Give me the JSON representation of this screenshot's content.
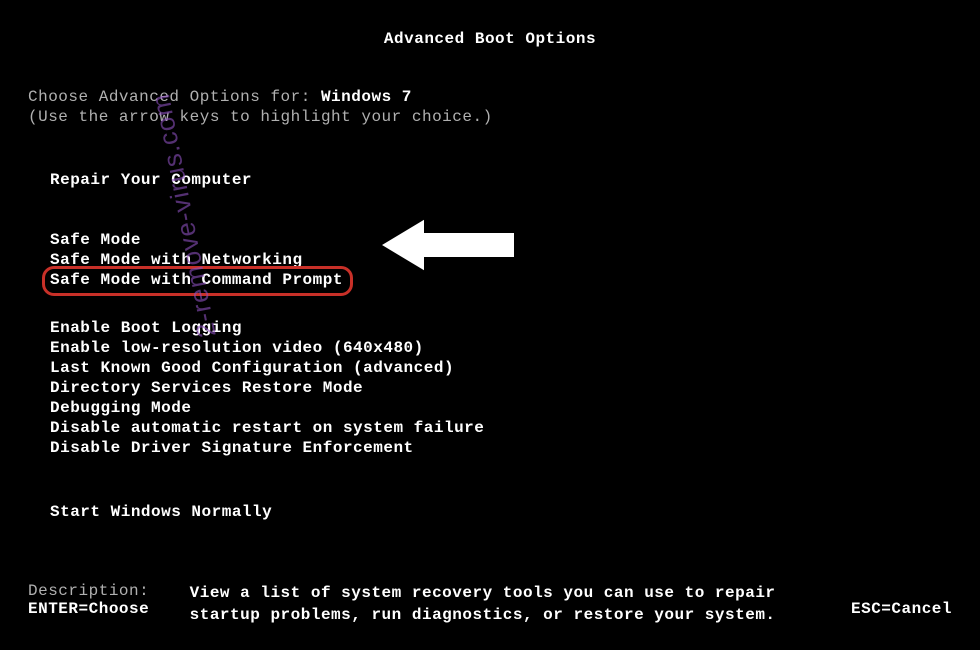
{
  "header": {
    "title": "Advanced Boot Options"
  },
  "choose": {
    "prefix": "Choose Advanced Options for: ",
    "os_name": "Windows 7",
    "hint": "(Use the arrow keys to highlight your choice.)"
  },
  "groups": {
    "repair": "Repair Your Computer",
    "safe": [
      "Safe Mode",
      "Safe Mode with Networking",
      "Safe Mode with Command Prompt"
    ],
    "advanced": [
      "Enable Boot Logging",
      "Enable low-resolution video (640x480)",
      "Last Known Good Configuration (advanced)",
      "Directory Services Restore Mode",
      "Debugging Mode",
      "Disable automatic restart on system failure",
      "Disable Driver Signature Enforcement"
    ],
    "normal": "Start Windows Normally"
  },
  "description": {
    "label": "Description:    ",
    "line1": "View a list of system recovery tools you can use to repair",
    "line2": "startup problems, run diagnostics, or restore your system."
  },
  "footer": {
    "enter": "ENTER=Choose",
    "esc": "ESC=Cancel"
  },
  "watermark": "2-remove-virus.com"
}
